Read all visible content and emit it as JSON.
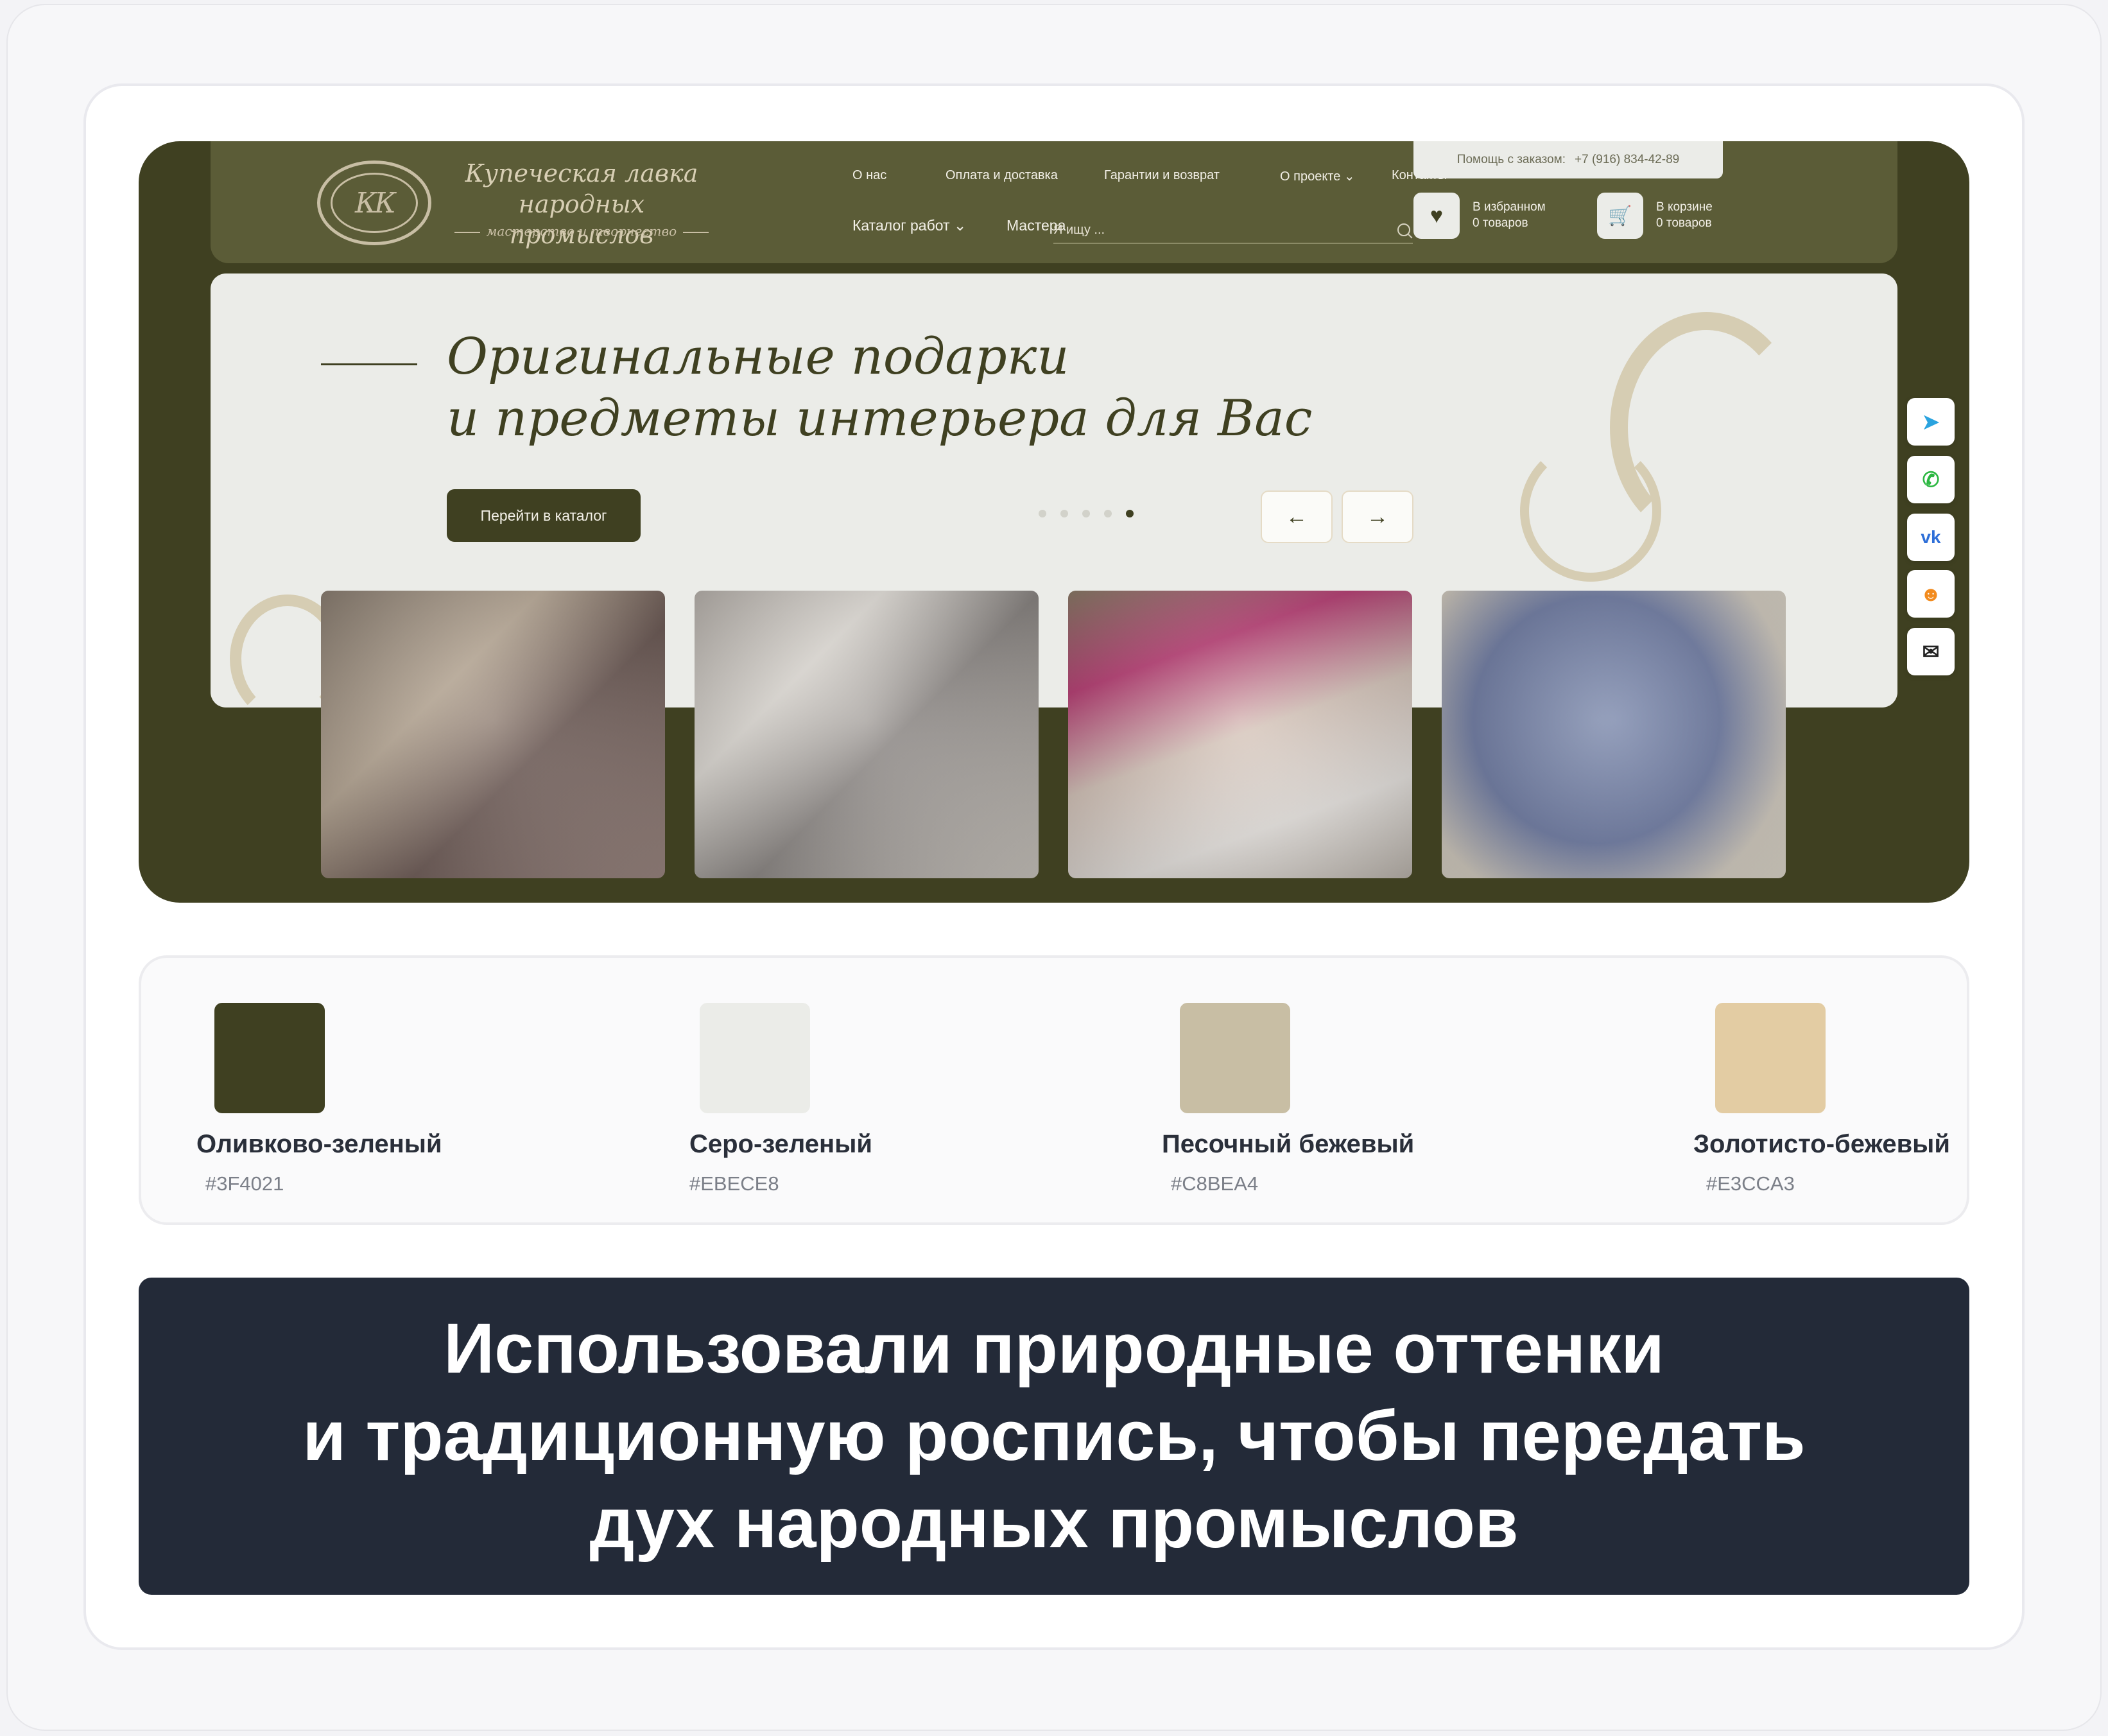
{
  "site": {
    "logo": {
      "mark": "КК",
      "title_line1": "Купеческая лавка",
      "title_line2": "народных промыслов",
      "subtitle": "мастерство и творчество"
    },
    "nav_top": [
      "О нас",
      "Оплата и доставка",
      "Гарантии и возврат",
      "О проекте ⌄",
      "Контакты"
    ],
    "nav_bottom": {
      "catalog": "Каталог работ ⌄",
      "masters": "Мастера"
    },
    "search_placeholder": "Я ищу ...",
    "help": {
      "label": "Помощь с заказом:",
      "phone": "+7 (916) 834-42-89"
    },
    "favorites": {
      "line1": "В избранном",
      "line2": "0 товаров"
    },
    "cart": {
      "line1": "В корзине",
      "line2": "0 товаров"
    },
    "hero": {
      "title_line1": "Оригинальные подарки",
      "title_line2": "и предметы интерьера для Вас",
      "button": "Перейти в каталог",
      "slides_total": 5,
      "slide_active": 5
    },
    "photos": [
      "photo-spools-and-petals",
      "photo-pearls-and-watch",
      "photo-flower-vase",
      "photo-epoxy-clock"
    ],
    "social": [
      "telegram-icon",
      "whatsapp-icon",
      "vk-icon",
      "odnoklassniki-icon",
      "mail-icon"
    ]
  },
  "palette": [
    {
      "name": "Оливково-зеленый",
      "hex": "#3F4021",
      "color": "#3f4021"
    },
    {
      "name": "Серо-зеленый",
      "hex": "#EBECE8",
      "color": "#ebece8"
    },
    {
      "name": "Песочный бежевый",
      "hex": "#C8BEA4",
      "color": "#c8bea4"
    },
    {
      "name": "Золотисто-бежевый",
      "hex": "#E3CCA3",
      "color": "#e3cca3"
    }
  ],
  "caption": {
    "line1": "Использовали природные оттенки",
    "line2": "и традиционную роспись, чтобы передать",
    "line3": "дух народных промыслов"
  }
}
